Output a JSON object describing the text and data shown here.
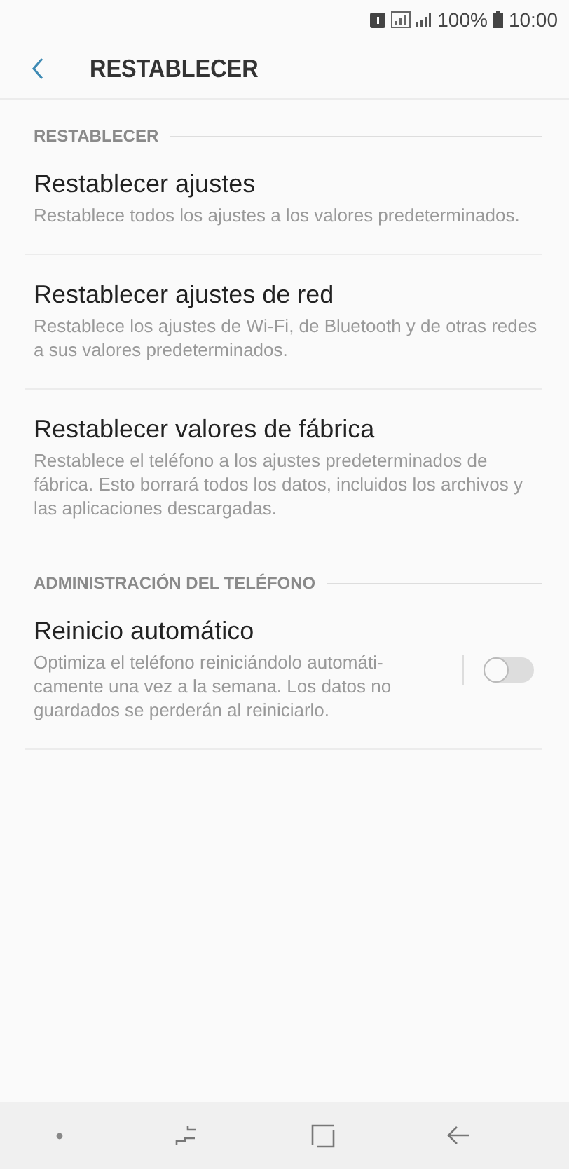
{
  "status_bar": {
    "battery": "100%",
    "time": "10:00"
  },
  "header": {
    "title": "RESTABLECER"
  },
  "sections": [
    {
      "title": "RESTABLECER",
      "items": [
        {
          "kind": "plain",
          "title": "Restablecer ajustes",
          "description": "Restablece todos los ajustes a los valores predeterminados."
        },
        {
          "kind": "plain",
          "title": "Restablecer ajustes de red",
          "description": "Restablece los ajustes de Wi-Fi, de Bluetooth y de otras redes a sus valores predeterminados."
        },
        {
          "kind": "plain",
          "title": "Restablecer valores de fábrica",
          "description": "Restablece el teléfono a los ajustes predeterminados de fábrica. Esto borrará todos los datos, incluidos los archivos y las aplicaciones descargadas."
        }
      ]
    },
    {
      "title": "ADMINISTRACIÓN DEL TELÉFONO",
      "items": [
        {
          "kind": "toggle",
          "title": "Reinicio automático",
          "description": "Optimiza el teléfono reiniciándolo automáti-camente una vez a la semana. Los datos no guardados se perderán al reiniciarlo.",
          "on": false
        }
      ]
    }
  ]
}
